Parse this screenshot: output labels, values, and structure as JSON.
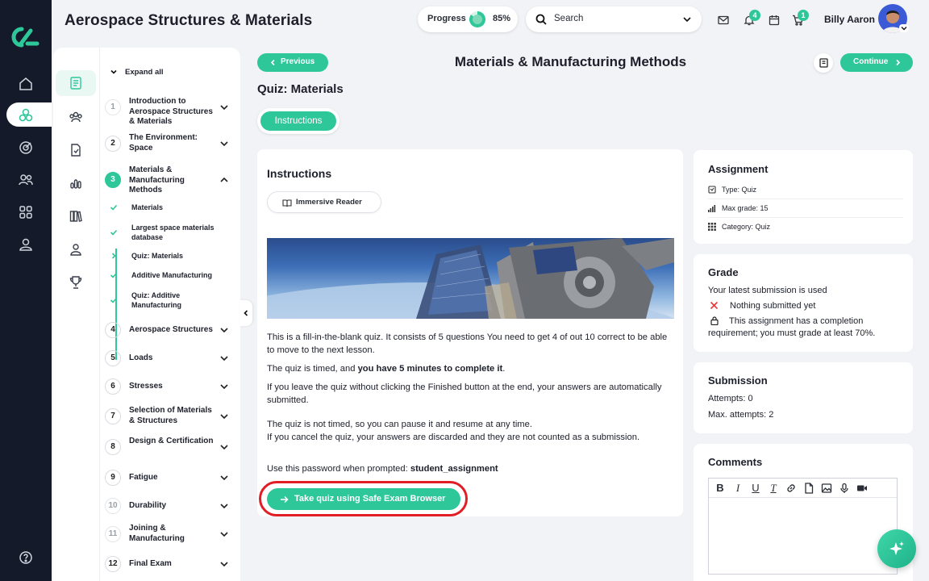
{
  "app": {
    "title": "Aerospace Structures & Materials"
  },
  "header": {
    "progress_label": "Progress",
    "progress_value": "85%",
    "progress_fraction": 0.85,
    "search_placeholder": "Search",
    "notifications_count": "4",
    "cart_count": "1",
    "user_name": "Billy Aaron"
  },
  "rail": {
    "items": [
      "home-icon",
      "courses-icon",
      "target-icon",
      "users-icon",
      "grid-icon",
      "profile-icon",
      "help-icon"
    ]
  },
  "nav": {
    "expand_all": "Expand all",
    "sections": [
      {
        "num": "1",
        "label": "Introduction to Aerospace Structures & Materials"
      },
      {
        "num": "2",
        "label": "The Environment: Space"
      },
      {
        "num": "3",
        "label": "Materials & Manufacturing Methods"
      },
      {
        "num": "4",
        "label": "Aerospace Structures"
      },
      {
        "num": "5",
        "label": "Loads"
      },
      {
        "num": "6",
        "label": "Stresses"
      },
      {
        "num": "7",
        "label": "Selection of Materials & Structures"
      },
      {
        "num": "8",
        "label": "Design & Certification"
      },
      {
        "num": "9",
        "label": "Fatigue"
      },
      {
        "num": "10",
        "label": "Durability"
      },
      {
        "num": "11",
        "label": "Joining & Manufacturing"
      },
      {
        "num": "12",
        "label": "Final Exam"
      }
    ],
    "sub_items": [
      {
        "label": "Materials"
      },
      {
        "label": "Largest space materials database"
      },
      {
        "label": "Quiz: Materials"
      },
      {
        "label": "Additive Manufacturing"
      },
      {
        "label": "Quiz: Additive Manufacturing"
      }
    ]
  },
  "main": {
    "previous_label": "Previous",
    "continue_label": "Continue",
    "page_heading": "Materials & Manufacturing Methods",
    "quiz_title": "Quiz: Materials",
    "tab_instructions": "Instructions",
    "card_heading": "Instructions",
    "immersive_reader": "Immersive Reader",
    "p1": "This is a fill-in-the-blank quiz. It consists of 5 questions You need to get 4 of out 10 correct to be able to move to the next lesson.",
    "p2_pre": "The quiz is timed, and ",
    "p2_bold": "you have 5 minutes to complete it",
    "p2_post": ".",
    "p3": "If you leave the quiz without clicking the Finished button at the end, your answers are automatically submitted.",
    "p4": "The quiz is not timed, so you can pause it and resume at any time.",
    "p5": "If you cancel the quiz, your answers are discarded and they are not counted as a submission.",
    "p6_pre": "Use this password when prompted: ",
    "p6_bold": "student_assignment",
    "quiz_button": "Take quiz using Safe Exam Browser"
  },
  "assignment": {
    "title": "Assignment",
    "type": "Type: Quiz",
    "max_grade": "Max grade: 15",
    "category": "Category: Quiz"
  },
  "grade": {
    "title": "Grade",
    "latest": "Your latest submission is used",
    "nothing": "Nothing submitted yet",
    "requirement": "This assignment has a completion requirement; you must grade at least 70%."
  },
  "submission": {
    "title": "Submission",
    "attempts": "Attempts: 0",
    "max_attempts": "Max. attempts: 2"
  },
  "comments": {
    "title": "Comments"
  },
  "colors": {
    "accent": "#2ec79a",
    "rail": "#141a2a",
    "highlight_ring": "#e11d25"
  }
}
